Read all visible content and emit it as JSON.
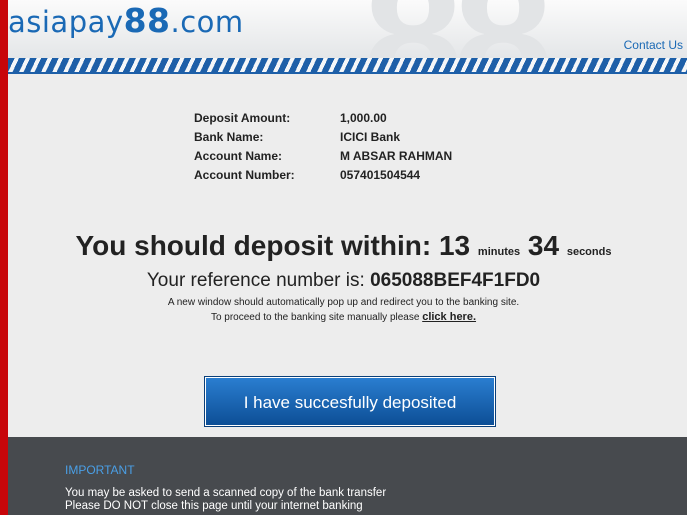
{
  "header": {
    "logo_text": "asiapay",
    "logo_number": "88",
    "logo_suffix": ".com",
    "contact_label": "Contact Us"
  },
  "details": {
    "rows": [
      {
        "label": "Deposit Amount:",
        "value": "1,000.00"
      },
      {
        "label": "Bank Name:",
        "value": "ICICI Bank"
      },
      {
        "label": "Account Name:",
        "value": "M ABSAR RAHMAN"
      },
      {
        "label": "Account Number:",
        "value": "057401504544"
      }
    ]
  },
  "countdown": {
    "prefix": "You should deposit within:",
    "minutes": "13",
    "minutes_label": "minutes",
    "seconds": "34",
    "seconds_label": "seconds"
  },
  "reference": {
    "prefix": "Your reference number is:",
    "code": "065088BEF4F1FD0"
  },
  "info": {
    "line1": "A new window should automatically pop up and redirect you to the banking site.",
    "line2": "To proceed to the banking site manually please",
    "link": "click here."
  },
  "confirm_button": "I have succesfully deposited",
  "footer": {
    "heading": "IMPORTANT",
    "line1": "You may be asked to send a scanned copy of the bank transfer",
    "line2": "Please DO NOT close this page until your internet banking"
  },
  "colors": {
    "brand_blue": "#1a69b5",
    "border_red": "#c8060a",
    "footer_bg": "#474a4e"
  }
}
